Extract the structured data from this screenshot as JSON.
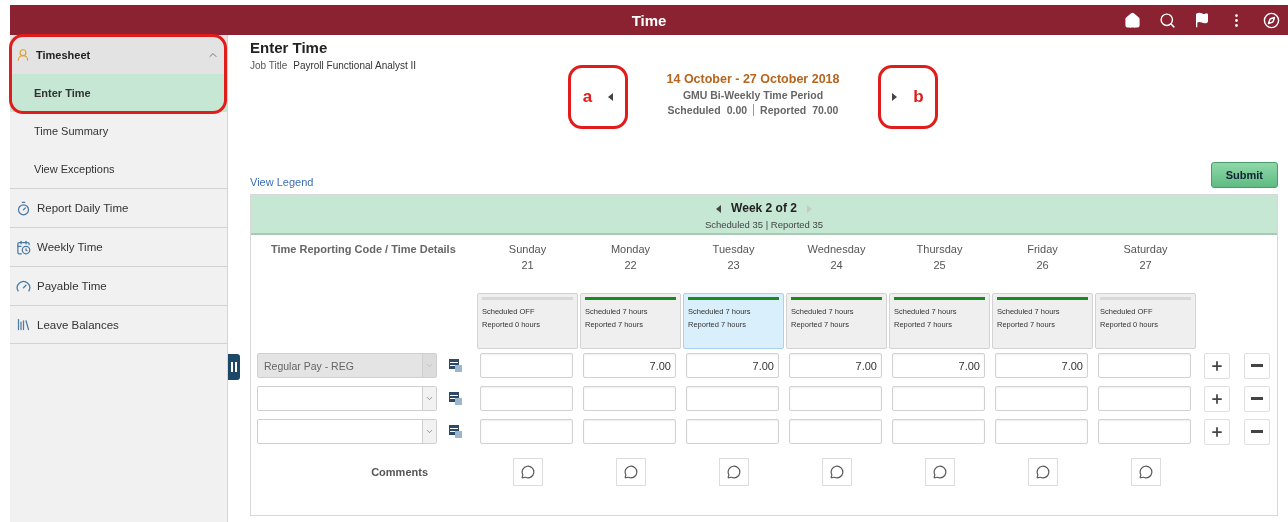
{
  "header": {
    "title": "Time"
  },
  "sidebar": {
    "section": {
      "label": "Timesheet",
      "expanded": true,
      "annotated": true,
      "items": [
        {
          "label": "Enter Time",
          "selected": true
        },
        {
          "label": "Time Summary",
          "selected": false
        },
        {
          "label": "View Exceptions",
          "selected": false
        }
      ]
    },
    "links": [
      {
        "label": "Report Daily Time"
      },
      {
        "label": "Weekly Time"
      },
      {
        "label": "Payable Time"
      },
      {
        "label": "Leave Balances"
      }
    ]
  },
  "page": {
    "title": "Enter Time",
    "job_title_label": "Job Title",
    "job_title": "Payroll Functional Analyst II"
  },
  "period": {
    "range": "14 October - 27 October 2018",
    "name": "GMU Bi-Weekly Time Period",
    "scheduled_label": "Scheduled",
    "scheduled": "0.00",
    "reported_label": "Reported",
    "reported": "70.00",
    "prev_callout": "a",
    "next_callout": "b"
  },
  "view_legend": "View Legend",
  "submit": "Submit",
  "week": {
    "title": "Week 2 of 2",
    "summary": "Scheduled 35 | Reported 35",
    "prev_disabled": false,
    "next_disabled": true
  },
  "grid": {
    "code_header": "Time Reporting Code / Time Details",
    "comments_label": "Comments",
    "days": [
      {
        "name": "Sunday",
        "date": "21",
        "scheduled": "Scheduled OFF",
        "reported": "Reported 0 hours",
        "on_schedule": false,
        "selected": false
      },
      {
        "name": "Monday",
        "date": "22",
        "scheduled": "Scheduled 7 hours",
        "reported": "Reported 7 hours",
        "on_schedule": true,
        "selected": false
      },
      {
        "name": "Tuesday",
        "date": "23",
        "scheduled": "Scheduled 7 hours",
        "reported": "Reported 7 hours",
        "on_schedule": true,
        "selected": true
      },
      {
        "name": "Wednesday",
        "date": "24",
        "scheduled": "Scheduled 7 hours",
        "reported": "Reported 7 hours",
        "on_schedule": true,
        "selected": false
      },
      {
        "name": "Thursday",
        "date": "25",
        "scheduled": "Scheduled 7 hours",
        "reported": "Reported 7 hours",
        "on_schedule": true,
        "selected": false
      },
      {
        "name": "Friday",
        "date": "26",
        "scheduled": "Scheduled 7 hours",
        "reported": "Reported 7 hours",
        "on_schedule": true,
        "selected": false
      },
      {
        "name": "Saturday",
        "date": "27",
        "scheduled": "Scheduled OFF",
        "reported": "Reported 0 hours",
        "on_schedule": false,
        "selected": false
      }
    ],
    "rows": [
      {
        "code": "Regular Pay - REG",
        "disabled": true,
        "hours": [
          {
            "kind": "blank"
          },
          {
            "kind": "entry",
            "value": "7.00"
          },
          {
            "kind": "entry",
            "value": "7.00"
          },
          {
            "kind": "entry",
            "value": "7.00"
          },
          {
            "kind": "entry",
            "value": "7.00"
          },
          {
            "kind": "entry",
            "value": "7.00"
          },
          {
            "kind": "blank"
          }
        ]
      },
      {
        "disabled": false
      },
      {
        "disabled": false
      }
    ]
  }
}
